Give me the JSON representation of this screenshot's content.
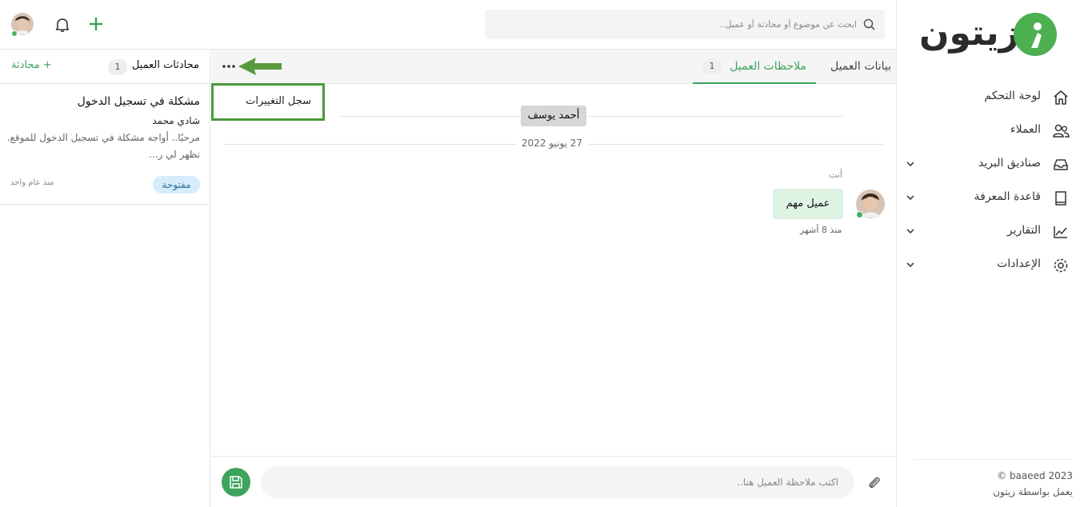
{
  "brand": {
    "name": "زيتون",
    "color": "#4caf50"
  },
  "sidebar": {
    "items": [
      {
        "label": "لوحة التحكم",
        "icon": "home-icon",
        "has_submenu": false
      },
      {
        "label": "العملاء",
        "icon": "users-icon",
        "has_submenu": false
      },
      {
        "label": "صناديق البريد",
        "icon": "inbox-icon",
        "has_submenu": true
      },
      {
        "label": "قاعدة المعرفة",
        "icon": "book-icon",
        "has_submenu": true
      },
      {
        "label": "التقارير",
        "icon": "chart-icon",
        "has_submenu": true
      },
      {
        "label": "الإعدادات",
        "icon": "gear-icon",
        "has_submenu": true
      }
    ],
    "footer": {
      "copyright": "© baaeed 2023",
      "powered": "يعمل بواسطة زيتون"
    }
  },
  "topbar": {
    "search_placeholder": "ابحث عن موضوع أو محادثة أو عميل..",
    "add_icon": "plus-icon",
    "bell_icon": "bell-icon",
    "user_status": "online"
  },
  "conversations": {
    "title": "محادثات العميل",
    "count": "1",
    "new_label": "+ محادثة",
    "items": [
      {
        "subject": "مشكلة في تسجيل الدخول",
        "customer": "شادي محمد",
        "preview_line1": "مرحبًا.. أواجه مشكلة في تسجيل الدخول للموقع.",
        "preview_line2": "تظهر لي ر...",
        "status": "مفتوحة",
        "time": "منذ عام واحد"
      }
    ]
  },
  "tabs": [
    {
      "label": "بيانات العميل",
      "active": false
    },
    {
      "label": "ملاحظات العميل",
      "active": true,
      "count": "1"
    }
  ],
  "menu": {
    "changelog_label": "سجل التغييرات"
  },
  "notes": {
    "customer_chip": "أحمد يوسف",
    "date_separator": "27 يونيو 2022",
    "items": [
      {
        "author": "أنت",
        "text": "عميل مهم",
        "time": "منذ 8 أشهر"
      }
    ]
  },
  "composer": {
    "placeholder": "اكتب ملاحظة العميل هنا.."
  },
  "colors": {
    "accent": "#3da35d",
    "annotation": "#4a9a3c",
    "note_bubble": "#dff3e4",
    "status_badge": "#d6ecfb"
  }
}
